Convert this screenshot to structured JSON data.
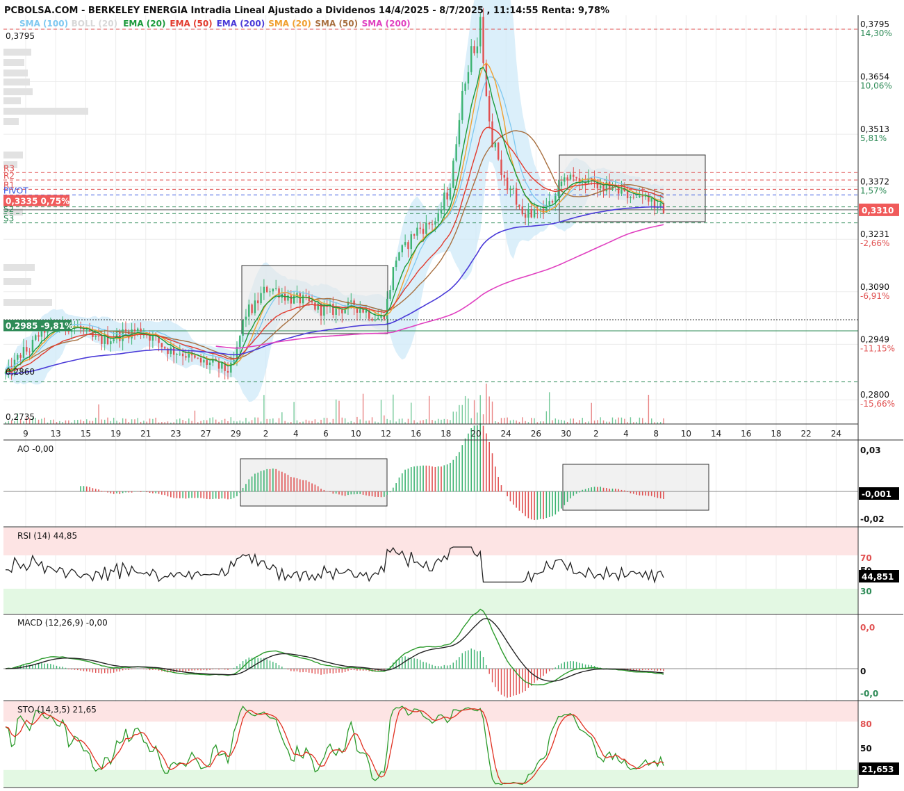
{
  "header": {
    "title": "PCBOLSA.COM - BERKELEY ENERGIA Intradia Lineal Ajustado a Dividenos 14/4/2025 - 8/7/2025 , 11:14:55 Renta: 9,78%"
  },
  "legend": [
    {
      "label": "SMA (100)",
      "color": "#7ec8f0"
    },
    {
      "label": "BOLL (20)",
      "color": "#d8d8d8"
    },
    {
      "label": "EMA (20)",
      "color": "#1a9a3a"
    },
    {
      "label": "EMA (50)",
      "color": "#e23b2e"
    },
    {
      "label": "EMA (200)",
      "color": "#4a3ad8"
    },
    {
      "label": "SMA (20)",
      "color": "#f0a030"
    },
    {
      "label": "SMA (50)",
      "color": "#a87040"
    },
    {
      "label": "SMA (200)",
      "color": "#e040c0"
    }
  ],
  "colors": {
    "up": "#3cb371",
    "down": "#e05050",
    "boll_fill": "#cfe9f8",
    "price_tag": "#f05a5a",
    "level_tag": "#2e8b57",
    "box_fill": "#e8e8e8"
  },
  "price_panel": {
    "top_left_label": "0,3795",
    "bottom_left_labels": [
      "0,2860",
      "0,2735"
    ],
    "ticks": [
      {
        "value": 0.3795,
        "label": "0,3795",
        "pct": "14,30%",
        "pct_color": "#2e8b57"
      },
      {
        "value": 0.3654,
        "label": "0,3654",
        "pct": "10,06%",
        "pct_color": "#2e8b57"
      },
      {
        "value": 0.3513,
        "label": "0,3513",
        "pct": "5,81%",
        "pct_color": "#2e8b57"
      },
      {
        "value": 0.3372,
        "label": "0,3372",
        "pct": "1,57%",
        "pct_color": "#2e8b57"
      },
      {
        "value": 0.3231,
        "label": "0,3231",
        "pct": "-2,66%",
        "pct_color": "#e05050"
      },
      {
        "value": 0.309,
        "label": "0,3090",
        "pct": "-6,91%",
        "pct_color": "#e05050"
      },
      {
        "value": 0.2949,
        "label": "0,2949",
        "pct": "-11,15%",
        "pct_color": "#e05050"
      },
      {
        "value": 0.28,
        "label": "0,2800",
        "pct": "-15,66%",
        "pct_color": "#e05050"
      }
    ],
    "current_price_tag": "0,3310",
    "current_price": 0.331,
    "left_tag_last": "0,3335  0,75%",
    "left_tag_last_value": 0.3335,
    "left_tag_low": "0,2985 -9,81%",
    "left_tag_low_value": 0.2985,
    "pivot_levels": [
      {
        "label": "R3",
        "value": 0.341,
        "color": "#e05050"
      },
      {
        "label": "R2",
        "value": 0.339,
        "color": "#e05050"
      },
      {
        "label": "R1",
        "value": 0.3365,
        "color": "#e05050"
      },
      {
        "label": "PIVOT",
        "value": 0.335,
        "color": "#3050e0"
      },
      {
        "label": "S1",
        "value": 0.3318,
        "color": "#2e8b57"
      },
      {
        "label": "S2",
        "value": 0.33,
        "color": "#2e8b57"
      },
      {
        "label": "S3",
        "value": 0.3275,
        "color": "#2e8b57"
      }
    ],
    "top_dashed": 0.3795,
    "bottom_dashed": 0.286
  },
  "x_axis": {
    "labels": [
      "9",
      "13",
      "15",
      "19",
      "21",
      "23",
      "27",
      "29",
      "2",
      "4",
      "6",
      "10",
      "12",
      "16",
      "18",
      "20",
      "24",
      "26",
      "30",
      "2",
      "4",
      "8",
      "10",
      "14",
      "16",
      "18",
      "22",
      "24"
    ]
  },
  "ao_panel": {
    "name": "AO",
    "value": "-0,00",
    "ticks": [
      "0,03",
      "-0,02"
    ],
    "tag": "-0,001"
  },
  "rsi_panel": {
    "name": "RSI (14)",
    "value": "44,85",
    "ticks": [
      "70",
      "50",
      "30"
    ],
    "tag": "44,851"
  },
  "macd_panel": {
    "name": "MACD (12,26,9)",
    "value": "-0,00",
    "ticks": [
      "0,0",
      "0",
      "-0,0"
    ],
    "tag": ""
  },
  "sto_panel": {
    "name": "STO (14,3,5)",
    "value": "21,65",
    "ticks": [
      "80",
      "50"
    ],
    "tag": "21,653"
  },
  "chart_data": {
    "type": "line",
    "title": "PCBOLSA.COM - BERKELEY ENERGIA Intradia Lineal Ajustado a Dividenos 14/4/2025 - 8/7/2025 , 11:14:55 Renta: 9,78%",
    "x": [
      "9",
      "13",
      "15",
      "19",
      "21",
      "23",
      "27",
      "29",
      "2",
      "4",
      "6",
      "10",
      "12",
      "16",
      "18",
      "20",
      "24",
      "26",
      "30",
      "2",
      "4",
      "8"
    ],
    "ylim": [
      0.2735,
      0.3795
    ],
    "series": [
      {
        "name": "Precio",
        "values": [
          0.287,
          0.299,
          0.301,
          0.298,
          0.297,
          0.294,
          0.292,
          0.291,
          0.306,
          0.308,
          0.306,
          0.304,
          0.303,
          0.321,
          0.322,
          0.372,
          0.337,
          0.33,
          0.34,
          0.338,
          0.336,
          0.333
        ]
      },
      {
        "name": "EMA (20)",
        "values": [
          0.289,
          0.296,
          0.299,
          0.298,
          0.297,
          0.296,
          0.294,
          0.292,
          0.301,
          0.305,
          0.305,
          0.304,
          0.303,
          0.312,
          0.318,
          0.345,
          0.338,
          0.332,
          0.336,
          0.336,
          0.335,
          0.334
        ]
      },
      {
        "name": "EMA (50)",
        "values": [
          0.29,
          0.294,
          0.297,
          0.297,
          0.297,
          0.296,
          0.295,
          0.293,
          0.298,
          0.302,
          0.303,
          0.303,
          0.303,
          0.308,
          0.313,
          0.332,
          0.337,
          0.334,
          0.336,
          0.336,
          0.335,
          0.334
        ]
      },
      {
        "name": "EMA (200)",
        "values": [
          0.287,
          0.289,
          0.291,
          0.292,
          0.293,
          0.293,
          0.293,
          0.292,
          0.294,
          0.296,
          0.297,
          0.298,
          0.298,
          0.302,
          0.304,
          0.313,
          0.321,
          0.324,
          0.327,
          0.329,
          0.33,
          0.331
        ]
      },
      {
        "name": "SMA (200)",
        "values": [
          null,
          null,
          null,
          null,
          null,
          null,
          null,
          null,
          null,
          0.296,
          0.297,
          0.298,
          0.299,
          0.3,
          0.302,
          0.308,
          0.316,
          0.32,
          0.323,
          0.326,
          0.329,
          0.331
        ]
      }
    ]
  }
}
